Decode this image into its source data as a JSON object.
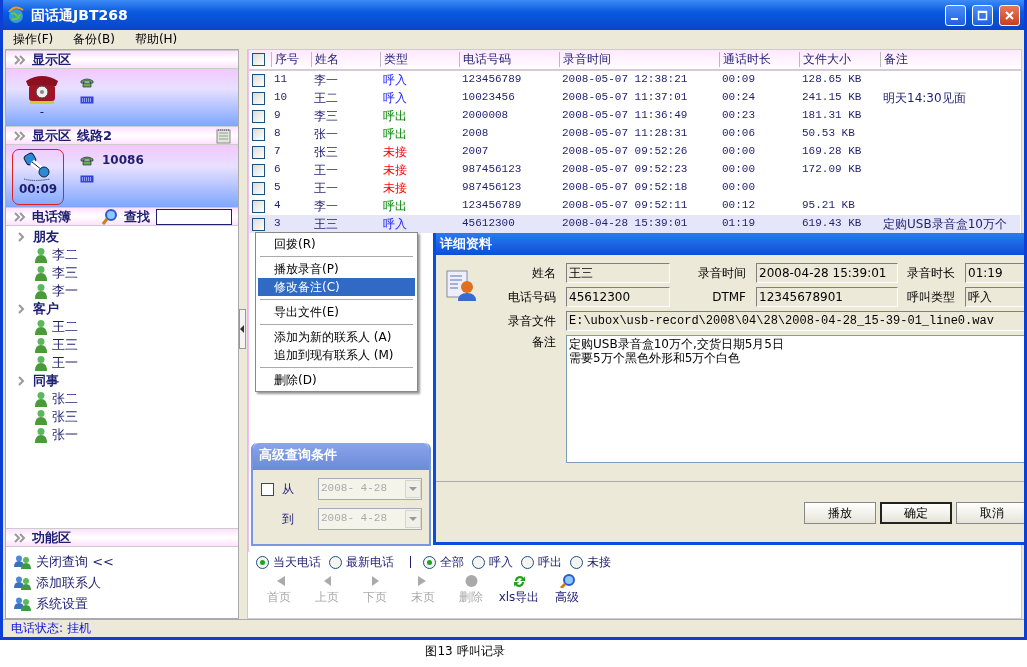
{
  "window": {
    "title": "固话通JBT268"
  },
  "menu": [
    {
      "label": "操作(F)"
    },
    {
      "label": "备份(B)"
    },
    {
      "label": "帮助(H)"
    }
  ],
  "line1": {
    "title": "显示区",
    "state": "-"
  },
  "line2": {
    "title": "显示区",
    "line": "线路2",
    "timer": "00:09",
    "number": "10086"
  },
  "phonebook": {
    "title": "电话簿",
    "search_label": "查找",
    "groups": [
      {
        "label": "朋友",
        "children": [
          {
            "label": "李二"
          },
          {
            "label": "李三"
          },
          {
            "label": "李一"
          }
        ]
      },
      {
        "label": "客户",
        "children": [
          {
            "label": "王二"
          },
          {
            "label": "王三"
          },
          {
            "label": "王一"
          }
        ]
      },
      {
        "label": "同事",
        "children": [
          {
            "label": "张二"
          },
          {
            "label": "张三"
          },
          {
            "label": "张一"
          }
        ]
      }
    ]
  },
  "functions": {
    "title": "功能区",
    "items": [
      {
        "label": "关闭查询 <<"
      },
      {
        "label": "添加联系人"
      },
      {
        "label": "系统设置"
      }
    ]
  },
  "status_bar": "电话状态: 挂机",
  "table": {
    "header_checked": false,
    "columns": [
      "序号",
      "姓名",
      "类型",
      "电话号码",
      "录音时间",
      "通话时长",
      "文件大小",
      "备注"
    ],
    "rows": [
      {
        "no": "11",
        "name": "李一",
        "type": "呼入",
        "kind": "incoming",
        "phone": "123456789",
        "time": "2008-05-07 12:38:21",
        "duration": "00:09",
        "size": "128.65 KB",
        "checked": false,
        "selected": false
      },
      {
        "no": "10",
        "name": "王二",
        "type": "呼入",
        "kind": "incoming",
        "phone": "10023456",
        "time": "2008-05-07 11:37:01",
        "duration": "00:24",
        "size": "241.15 KB",
        "remark": "明天14:30见面",
        "checked": false,
        "selected": false
      },
      {
        "no": "9",
        "name": "李三",
        "type": "呼出",
        "kind": "outgoing",
        "phone": "2000008",
        "time": "2008-05-07 11:36:49",
        "duration": "00:23",
        "size": "181.31 KB",
        "checked": false,
        "selected": false
      },
      {
        "no": "8",
        "name": "张一",
        "type": "呼出",
        "kind": "outgoing",
        "phone": "2008",
        "time": "2008-05-07 11:28:31",
        "duration": "00:06",
        "size": "50.53 KB",
        "checked": false,
        "selected": false
      },
      {
        "no": "7",
        "name": "张三",
        "type": "未接",
        "kind": "missed",
        "phone": "2007",
        "time": "2008-05-07 09:52:26",
        "duration": "00:00",
        "size": "169.28 KB",
        "checked": false,
        "selected": false
      },
      {
        "no": "6",
        "name": "王一",
        "type": "未接",
        "kind": "missed",
        "phone": "987456123",
        "time": "2008-05-07 09:52:23",
        "duration": "00:00",
        "size": "172.09 KB",
        "checked": false,
        "selected": false
      },
      {
        "no": "5",
        "name": "王一",
        "type": "未接",
        "kind": "missed",
        "phone": "987456123",
        "time": "2008-05-07 09:52:18",
        "duration": "00:00",
        "checked": false,
        "selected": false
      },
      {
        "no": "4",
        "name": "李一",
        "type": "呼出",
        "kind": "outgoing",
        "phone": "123456789",
        "time": "2008-05-07 09:52:11",
        "duration": "00:12",
        "size": "95.21 KB",
        "checked": false,
        "selected": false
      },
      {
        "no": "3",
        "name": "王三",
        "type": "呼入",
        "kind": "incoming",
        "phone": "45612300",
        "time": "2008-04-28 15:39:01",
        "duration": "01:19",
        "size": "619.43 KB",
        "remark": "定购USB录音盒10万个",
        "checked": false,
        "selected": true
      }
    ]
  },
  "context_menu": {
    "sections": [
      {
        "items": [
          {
            "label": "回拨(R)",
            "selected": false
          }
        ]
      },
      {
        "items": [
          {
            "label": "播放录音(P)",
            "selected": false
          },
          {
            "label": "修改备注(C)",
            "selected": true
          }
        ]
      },
      {
        "items": [
          {
            "label": "导出文件(E)",
            "selected": false
          }
        ]
      },
      {
        "items": [
          {
            "label": "添加为新的联系人 (A)",
            "selected": false
          },
          {
            "label": "追加到现有联系人 (M)",
            "selected": false
          }
        ]
      },
      {
        "items": [
          {
            "label": "删除(D)",
            "selected": false
          }
        ]
      }
    ]
  },
  "advanced_query": {
    "title": "高级查询条件",
    "checked": false,
    "from_label": "从",
    "from_date": "2008- 4-28",
    "to_label": "到",
    "to_date": "2008- 4-28"
  },
  "filters": {
    "date_options": [
      {
        "label": "当天电话",
        "selected": true
      },
      {
        "label": "最新电话",
        "selected": false
      }
    ],
    "type_options": [
      {
        "label": "全部",
        "selected": true
      },
      {
        "label": "呼入",
        "selected": false
      },
      {
        "label": "呼出",
        "selected": false
      },
      {
        "label": "未接",
        "selected": false
      }
    ]
  },
  "toolbar": [
    {
      "label": "首页",
      "kind": "first",
      "disabled": true
    },
    {
      "label": "上页",
      "kind": "prev",
      "disabled": true
    },
    {
      "label": "下页",
      "kind": "next",
      "disabled": true
    },
    {
      "label": "末页",
      "kind": "last",
      "disabled": true
    },
    {
      "label": "删除",
      "kind": "delete",
      "disabled": true
    },
    {
      "label": "xls导出",
      "kind": "export",
      "disabled": false
    },
    {
      "label": "高级",
      "kind": "search",
      "disabled": false
    }
  ],
  "dialog": {
    "title": "详细资料",
    "fields": [
      {
        "label": "姓名",
        "value": "王三"
      },
      {
        "label": "录音时间",
        "value": "2008-04-28 15:39:01"
      },
      {
        "label": "录音时长",
        "value": "01:19"
      },
      {
        "label": "电话号码",
        "value": "45612300"
      },
      {
        "label": "DTMF",
        "value": "12345678901"
      },
      {
        "label": "呼叫类型",
        "value": "呼入"
      }
    ],
    "file": {
      "label": "录音文件",
      "value": "E:\\ubox\\usb-record\\2008\\04\\28\\2008-04-28_15-39-01_line0.wav"
    },
    "remark": {
      "label": "备注",
      "lines": [
        "定购USB录音盒10万个,交货日期5月5日",
        "需要5万个黑色外形和5万个白色"
      ]
    },
    "buttons": [
      {
        "label": "播放",
        "default": false
      },
      {
        "label": "确定",
        "default": true
      },
      {
        "label": "取消",
        "default": false
      }
    ]
  },
  "caption": "图13 呼叫记录"
}
